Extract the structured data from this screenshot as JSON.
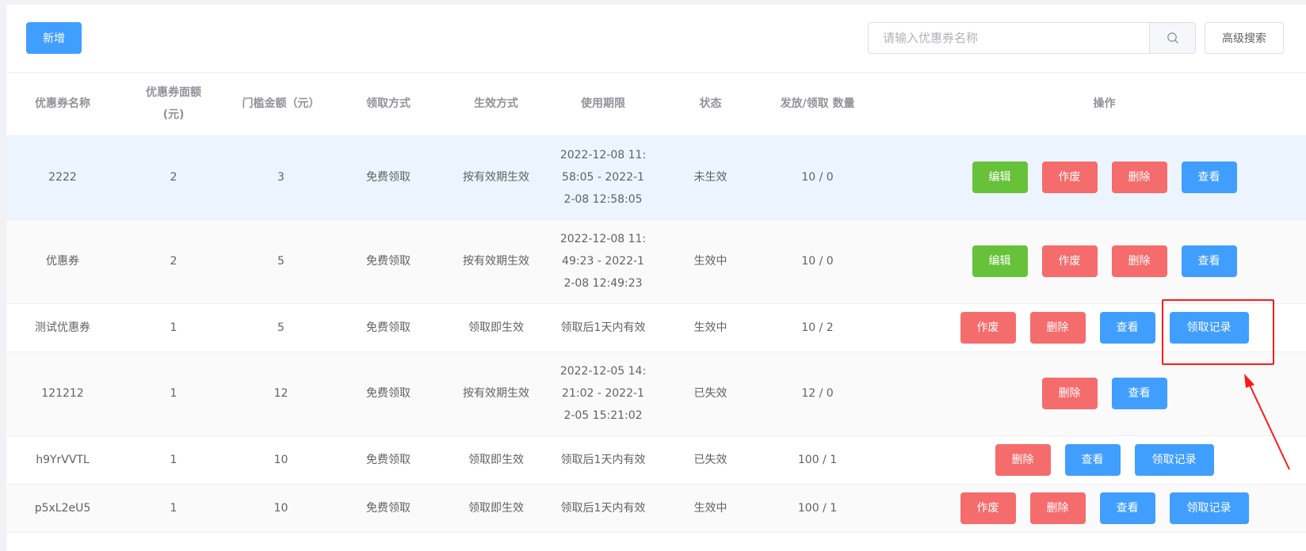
{
  "toolbar": {
    "add_label": "新增",
    "search_placeholder": "请输入优惠券名称",
    "advanced_search_label": "高级搜索",
    "search_icon": "search-icon"
  },
  "table": {
    "headers": [
      "优惠券名称",
      "优惠券面额\n(元)",
      "门槛金额（元）",
      "领取方式",
      "生效方式",
      "使用期限",
      "状态",
      "发放/领取 数量",
      "操作"
    ],
    "rows": [
      {
        "name": "2222",
        "face_value": "2",
        "threshold": "3",
        "claim_method": "免费领取",
        "effect_method": "按有效期生效",
        "period": "2022-12-08 11:58:05 - 2022-12-08 12:58:05",
        "status": "未生效",
        "quantity": "10 / 0",
        "actions": [
          "编辑",
          "作废",
          "删除",
          "查看"
        ]
      },
      {
        "name": "优惠券",
        "face_value": "2",
        "threshold": "5",
        "claim_method": "免费领取",
        "effect_method": "按有效期生效",
        "period": "2022-12-08 11:49:23 - 2022-12-08 12:49:23",
        "status": "生效中",
        "quantity": "10 / 0",
        "actions": [
          "编辑",
          "作废",
          "删除",
          "查看"
        ]
      },
      {
        "name": "测试优惠券",
        "face_value": "1",
        "threshold": "5",
        "claim_method": "免费领取",
        "effect_method": "领取即生效",
        "period": "领取后1天内有效",
        "status": "生效中",
        "quantity": "10 / 2",
        "actions": [
          "作废",
          "删除",
          "查看",
          "领取记录"
        ]
      },
      {
        "name": "121212",
        "face_value": "1",
        "threshold": "12",
        "claim_method": "免费领取",
        "effect_method": "按有效期生效",
        "period": "2022-12-05 14:21:02 - 2022-12-05 15:21:02",
        "status": "已失效",
        "quantity": "12 / 0",
        "actions": [
          "删除",
          "查看"
        ]
      },
      {
        "name": "h9YrVVTL",
        "face_value": "1",
        "threshold": "10",
        "claim_method": "免费领取",
        "effect_method": "领取即生效",
        "period": "领取后1天内有效",
        "status": "已失效",
        "quantity": "100 / 1",
        "actions": [
          "删除",
          "查看",
          "领取记录"
        ]
      },
      {
        "name": "p5xL2eU5",
        "face_value": "1",
        "threshold": "10",
        "claim_method": "免费领取",
        "effect_method": "领取即生效",
        "period": "领取后1天内有效",
        "status": "生效中",
        "quantity": "100 / 1",
        "actions": [
          "作废",
          "删除",
          "查看",
          "领取记录"
        ]
      }
    ]
  },
  "colors": {
    "primary": "#409eff",
    "success": "#67c23a",
    "danger": "#f56c6c",
    "annotation": "#ff1a1a"
  }
}
